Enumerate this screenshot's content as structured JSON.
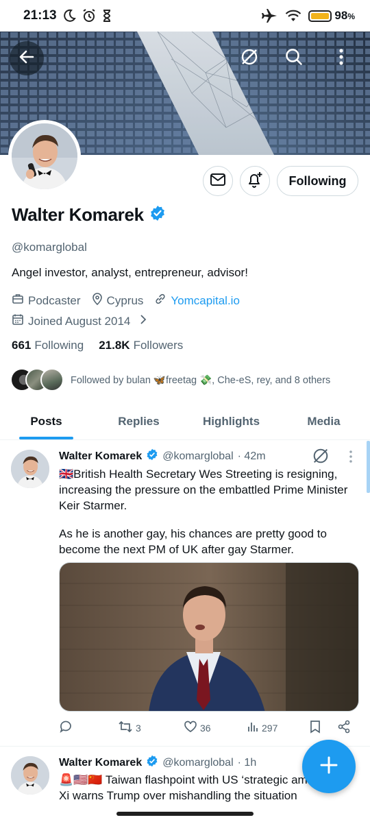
{
  "status_bar": {
    "time": "21:13",
    "battery": "98",
    "battery_unit": "%",
    "battery_level": 0.98,
    "icons": [
      "moon-icon",
      "alarm-icon",
      "hourglass-icon",
      "airplane-icon",
      "wifi-icon",
      "battery-icon"
    ]
  },
  "header": {
    "icons": [
      "back-arrow-icon",
      "grok-icon",
      "search-icon",
      "more-vertical-icon"
    ]
  },
  "profile": {
    "name": "Walter Komarek",
    "handle": "@komarglobal",
    "bio": "Angel investor, analyst, entrepreneur, advisor!",
    "category": "Podcaster",
    "location": "Cyprus",
    "website": "Yomcapital.io",
    "joined": "Joined August 2014",
    "following_count": "661",
    "following_label": "Following",
    "followers_count": "21.8K",
    "followers_label": "Followers",
    "followed_by": "Followed by bulan 🦋freetag 💸, Che-eS, rey, and 8 others",
    "follow_button": "Following"
  },
  "tabs": [
    {
      "label": "Posts",
      "active": true
    },
    {
      "label": "Replies",
      "active": false
    },
    {
      "label": "Highlights",
      "active": false
    },
    {
      "label": "Media",
      "active": false
    }
  ],
  "tweets": [
    {
      "name": "Walter Komarek",
      "handle": "@komarglobal",
      "time": "· 42m",
      "text_p1": "🇬🇧British Health Secretary Wes Streeting is resigning, increasing the pressure on the embattled Prime Minister Keir Starmer.",
      "text_p2": "As he is another gay, his chances are pretty good to become the next PM of UK after gay Starmer.",
      "replies": "",
      "reposts": "3",
      "likes": "36",
      "views": "297"
    },
    {
      "name": "Walter Komarek",
      "handle": "@komarglobal",
      "time": "· 1h",
      "text": "🚨🇺🇸🇨🇳 Taiwan flashpoint with US ‘strategic ambiguity’: Xi warns Trump over mishandling the situation"
    }
  ],
  "colors": {
    "accent": "#1d9bf0",
    "verified": "#1d9bf0",
    "text_primary": "#0f1419",
    "text_secondary": "#536471",
    "border": "#cfd9de"
  }
}
